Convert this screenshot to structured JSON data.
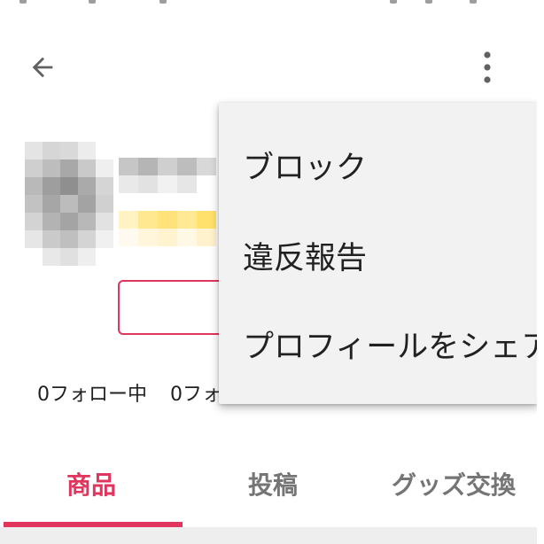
{
  "header": {
    "back_icon": "arrow-back-icon",
    "more_icon": "more-vert-icon"
  },
  "profile": {
    "follow_stats": [
      "0フォロー中",
      "0フォ"
    ]
  },
  "tabs": [
    {
      "label": "商品",
      "active": true
    },
    {
      "label": "投稿",
      "active": false
    },
    {
      "label": "グッズ交換",
      "active": false
    }
  ],
  "menu": {
    "items": [
      {
        "label": "ブロック"
      },
      {
        "label": "違反報告"
      },
      {
        "label": "プロフィールをシェア"
      }
    ]
  },
  "colors": {
    "accent": "#e0365d",
    "menu_background": "#f2f2f2",
    "tab_inactive": "#757575"
  }
}
